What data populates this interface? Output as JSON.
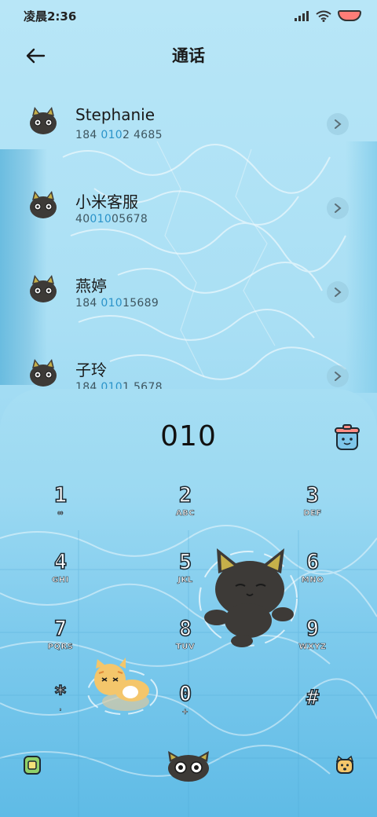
{
  "status_bar": {
    "time": "凌晨2:36",
    "icons": [
      "signal-icon",
      "wifi-icon",
      "battery-icon"
    ],
    "battery_color": "#ff7d77"
  },
  "header": {
    "title": "通话",
    "back_icon": "arrow-left-icon"
  },
  "contacts": [
    {
      "name": "Stephanie",
      "number_pre": "184 ",
      "number_hl": "010",
      "number_post": "2 4685"
    },
    {
      "name": "小米客服",
      "number_pre": "40",
      "number_hl": "010",
      "number_post": "05678"
    },
    {
      "name": "燕婷",
      "number_pre": "184 ",
      "number_hl": "010",
      "number_post": "15689"
    },
    {
      "name": "子玲",
      "number_pre": "184 ",
      "number_hl": "010",
      "number_post": "1 5678"
    }
  ],
  "dial": {
    "input": "010",
    "clear_icon": "trash-bucket-icon"
  },
  "keypad": [
    {
      "digit": "1",
      "letters": "∞"
    },
    {
      "digit": "2",
      "letters": "ABC"
    },
    {
      "digit": "3",
      "letters": "DEF"
    },
    {
      "digit": "4",
      "letters": "GHI"
    },
    {
      "digit": "5",
      "letters": "JKL"
    },
    {
      "digit": "6",
      "letters": "MNO"
    },
    {
      "digit": "7",
      "letters": "PQRS"
    },
    {
      "digit": "8",
      "letters": "TUV"
    },
    {
      "digit": "9",
      "letters": "WXYZ"
    },
    {
      "digit": "*",
      "letters": "'"
    },
    {
      "digit": "0",
      "letters": "+"
    },
    {
      "digit": "#",
      "letters": ""
    }
  ],
  "bottom_bar": {
    "left_icon": "contacts-card-icon",
    "center_icon": "cat-call-button-icon",
    "right_icon": "cat-face-icon"
  },
  "colors": {
    "highlight": "#2a93c9",
    "panel": "#9bd9f2",
    "cat_dark": "#3d3a37"
  }
}
